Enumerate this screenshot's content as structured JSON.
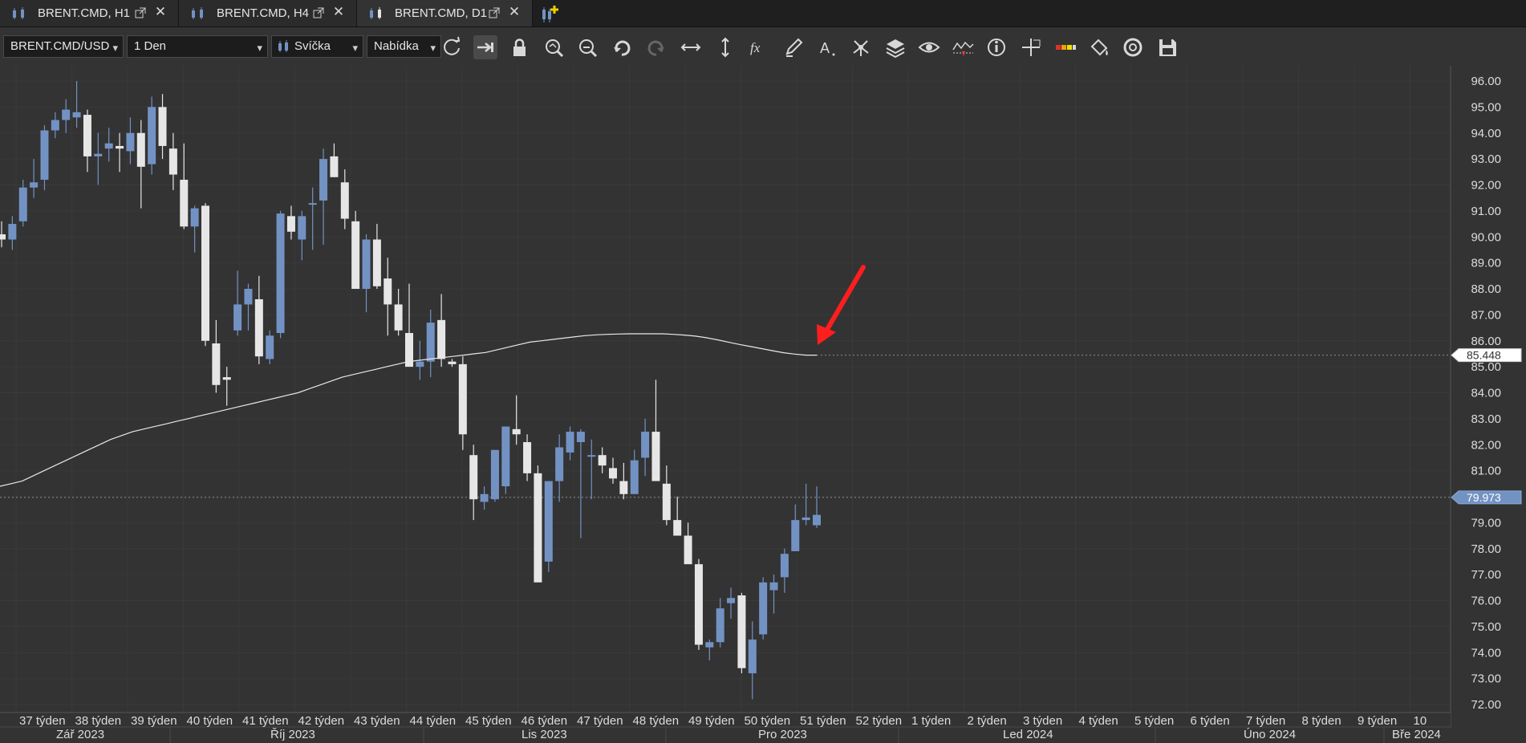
{
  "tabs": [
    {
      "label": "BRENT.CMD, H1",
      "active": false
    },
    {
      "label": "BRENT.CMD, H4",
      "active": false
    },
    {
      "label": "BRENT.CMD, D1",
      "active": true
    }
  ],
  "toolbar": {
    "instrument": "BRENT.CMD/USD",
    "period": "1 Den",
    "chart_style": "Svíčka",
    "price_side": "Nabídka",
    "icons": [
      "refresh-icon",
      "autoshift-icon",
      "lock-icon",
      "zoom-in-icon",
      "zoom-out-icon",
      "undo-icon",
      "redo-icon",
      "horizontal-scale-icon",
      "vertical-scale-icon",
      "indicators-icon",
      "drawing-pen-icon",
      "text-tool-icon",
      "patterns-icon",
      "layers-icon",
      "eye-icon",
      "chart-events-icon",
      "info-icon",
      "crosshair-icon",
      "color-theme-icon",
      "paint-bucket-icon",
      "screenshot-icon",
      "save-icon"
    ]
  },
  "colors": {
    "background": "#333333",
    "bull": "#7392c4",
    "bear": "#e6e6e6",
    "grid": "#3a3a3a",
    "ma_line": "#e8e8e8",
    "price_tag": "#7392c4",
    "arrow": "#ff1e1e"
  },
  "chart_data": {
    "type": "candlestick",
    "y_ticks": [
      "96.00",
      "95.00",
      "94.00",
      "93.00",
      "92.00",
      "91.00",
      "90.00",
      "89.00",
      "88.00",
      "87.00",
      "86.00",
      "85.00",
      "84.00",
      "83.00",
      "82.00",
      "81.00",
      "80.00",
      "79.00",
      "78.00",
      "77.00",
      "76.00",
      "75.00",
      "74.00",
      "73.00",
      "72.00"
    ],
    "ylim": [
      71.6,
      96.5
    ],
    "week_labels": [
      "37 týden",
      "38 týden",
      "39 týden",
      "40 týden",
      "41 týden",
      "42 týden",
      "43 týden",
      "44 týden",
      "45 týden",
      "46 týden",
      "47 týden",
      "48 týden",
      "49 týden",
      "50 týden",
      "51 týden",
      "52 týden",
      "1 týden",
      "2 týden",
      "3 týden",
      "4 týden",
      "5 týden",
      "6 týden",
      "7 týden",
      "8 týden",
      "9 týden",
      "10"
    ],
    "month_labels": [
      {
        "label": "Zář 2023",
        "week": 0
      },
      {
        "label": "Říj 2023",
        "week": 4.5
      },
      {
        "label": "Lis 2023",
        "week": 9
      },
      {
        "label": "Pro 2023",
        "week": 13.5
      },
      {
        "label": "Led 2024",
        "week": 18
      },
      {
        "label": "Úno 2024",
        "week": 22.5
      },
      {
        "label": "Bře 2024",
        "week": 25
      }
    ],
    "candles": [
      [
        90.1,
        90.6,
        89.6,
        89.9
      ],
      [
        89.9,
        90.8,
        89.5,
        90.5
      ],
      [
        90.6,
        92.2,
        90.4,
        91.9
      ],
      [
        91.9,
        93.0,
        91.5,
        92.1
      ],
      [
        92.2,
        94.3,
        91.8,
        94.1
      ],
      [
        94.1,
        94.8,
        93.8,
        94.5
      ],
      [
        94.5,
        95.3,
        94.0,
        94.9
      ],
      [
        94.6,
        96.0,
        94.2,
        94.8
      ],
      [
        94.7,
        94.9,
        92.5,
        93.1
      ],
      [
        93.1,
        94.0,
        92.0,
        93.2
      ],
      [
        93.4,
        94.2,
        92.9,
        93.6
      ],
      [
        93.5,
        94.0,
        92.5,
        93.4
      ],
      [
        93.3,
        94.6,
        92.8,
        94.0
      ],
      [
        94.0,
        94.5,
        91.1,
        92.7
      ],
      [
        92.8,
        95.4,
        92.4,
        95.0
      ],
      [
        95.0,
        95.5,
        93.0,
        93.5
      ],
      [
        93.4,
        94.0,
        91.8,
        92.4
      ],
      [
        92.2,
        93.6,
        90.3,
        90.4
      ],
      [
        90.4,
        91.2,
        89.4,
        91.1
      ],
      [
        91.2,
        91.3,
        85.8,
        86.0
      ],
      [
        85.9,
        86.8,
        84.0,
        84.3
      ],
      [
        84.6,
        85.0,
        83.5,
        84.5
      ],
      [
        86.4,
        88.7,
        86.2,
        87.4
      ],
      [
        87.4,
        88.2,
        86.4,
        88.0
      ],
      [
        87.6,
        88.5,
        85.1,
        85.4
      ],
      [
        85.3,
        86.4,
        85.1,
        86.2
      ],
      [
        86.3,
        91.0,
        86.1,
        90.9
      ],
      [
        90.8,
        91.2,
        89.9,
        90.2
      ],
      [
        89.9,
        91.0,
        89.1,
        90.8
      ],
      [
        91.3,
        91.9,
        89.5,
        91.3
      ],
      [
        91.4,
        93.4,
        89.7,
        93.0
      ],
      [
        93.1,
        93.6,
        92.3,
        92.3
      ],
      [
        92.1,
        92.6,
        90.3,
        90.7
      ],
      [
        90.6,
        91.0,
        88.2,
        88.0
      ],
      [
        88.0,
        90.1,
        87.1,
        89.9
      ],
      [
        89.9,
        90.5,
        88.0,
        88.1
      ],
      [
        88.4,
        89.2,
        86.2,
        87.4
      ],
      [
        87.4,
        88.0,
        86.2,
        86.4
      ],
      [
        86.3,
        88.2,
        85.4,
        85.0
      ],
      [
        85.0,
        86.0,
        84.5,
        85.2
      ],
      [
        85.2,
        87.2,
        84.6,
        86.7
      ],
      [
        86.8,
        87.8,
        85.0,
        85.3
      ],
      [
        85.2,
        85.3,
        85.0,
        85.1
      ],
      [
        85.1,
        85.4,
        81.8,
        82.4
      ],
      [
        81.6,
        82.0,
        79.1,
        79.9
      ],
      [
        79.8,
        80.4,
        79.5,
        80.1
      ],
      [
        79.9,
        81.7,
        79.8,
        81.8
      ],
      [
        80.4,
        82.7,
        80.1,
        82.7
      ],
      [
        82.6,
        83.9,
        82.0,
        82.4
      ],
      [
        82.1,
        82.4,
        80.6,
        80.9
      ],
      [
        80.9,
        81.2,
        77.1,
        76.7
      ],
      [
        77.5,
        80.6,
        77.1,
        80.6
      ],
      [
        80.6,
        82.4,
        79.8,
        81.9
      ],
      [
        81.7,
        82.7,
        81.4,
        82.5
      ],
      [
        82.1,
        82.6,
        78.4,
        82.5
      ],
      [
        81.6,
        82.2,
        79.9,
        81.6
      ],
      [
        81.6,
        81.9,
        80.9,
        81.2
      ],
      [
        81.1,
        81.5,
        80.5,
        80.7
      ],
      [
        80.6,
        81.3,
        79.9,
        80.1
      ],
      [
        80.1,
        81.8,
        80.1,
        81.4
      ],
      [
        81.5,
        83.0,
        80.8,
        82.5
      ],
      [
        82.5,
        84.5,
        80.7,
        80.6
      ],
      [
        80.5,
        81.2,
        78.9,
        79.1
      ],
      [
        79.1,
        80.0,
        79.0,
        78.5
      ],
      [
        78.5,
        79.0,
        77.9,
        77.4
      ],
      [
        77.4,
        77.6,
        74.1,
        74.3
      ],
      [
        74.2,
        74.5,
        73.7,
        74.4
      ],
      [
        74.4,
        76.1,
        74.2,
        75.7
      ],
      [
        75.9,
        76.5,
        75.3,
        76.1
      ],
      [
        76.2,
        76.3,
        73.2,
        73.4
      ],
      [
        73.2,
        75.2,
        72.2,
        74.5
      ],
      [
        74.7,
        76.9,
        74.5,
        76.7
      ],
      [
        76.4,
        77.0,
        75.5,
        76.7
      ],
      [
        76.9,
        78.0,
        76.3,
        77.8
      ],
      [
        77.9,
        79.7,
        78.0,
        79.1
      ],
      [
        79.1,
        80.5,
        78.9,
        79.2
      ],
      [
        78.9,
        80.4,
        78.8,
        79.3
      ]
    ],
    "ma_series": [
      80.4,
      80.5,
      80.6,
      80.8,
      81.0,
      81.2,
      81.4,
      81.6,
      81.8,
      82.0,
      82.2,
      82.35,
      82.5,
      82.6,
      82.7,
      82.8,
      82.9,
      83.0,
      83.1,
      83.2,
      83.3,
      83.4,
      83.5,
      83.6,
      83.7,
      83.8,
      83.9,
      84.0,
      84.15,
      84.3,
      84.45,
      84.6,
      84.7,
      84.8,
      84.9,
      85.0,
      85.1,
      85.2,
      85.25,
      85.3,
      85.35,
      85.4,
      85.45,
      85.5,
      85.55,
      85.65,
      85.75,
      85.85,
      85.95,
      86.0,
      86.05,
      86.1,
      86.15,
      86.2,
      86.23,
      86.25,
      86.26,
      86.27,
      86.27,
      86.27,
      86.27,
      86.25,
      86.22,
      86.18,
      86.12,
      86.04,
      85.95,
      85.86,
      85.78,
      85.7,
      85.62,
      85.54,
      85.49,
      85.45,
      85.448
    ],
    "current_price_label": "79.973",
    "current_price": 79.973,
    "ma_value_label": "85.448",
    "ma_value": 85.448
  }
}
